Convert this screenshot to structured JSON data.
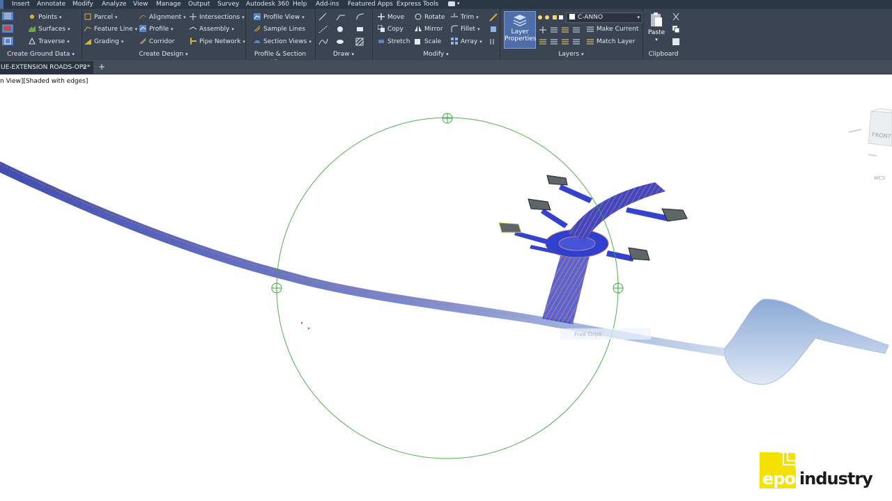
{
  "menu": [
    "Insert",
    "Annotate",
    "Modify",
    "Analyze",
    "View",
    "Manage",
    "Output",
    "Survey",
    "Autodesk 360",
    "Help",
    "Add-ins",
    "Featured Apps",
    "Express Tools"
  ],
  "ribbon": {
    "ground": {
      "title": "Create Ground Data",
      "points": "Points",
      "surfaces": "Surfaces",
      "traverse": "Traverse"
    },
    "design": {
      "title": "Create Design",
      "parcel": "Parcel",
      "feature_line": "Feature Line",
      "grading": "Grading",
      "alignment": "Alignment",
      "profile": "Profile",
      "corridor": "Corridor",
      "intersections": "Intersections",
      "assembly": "Assembly",
      "pipe_network": "Pipe Network"
    },
    "views": {
      "title": "Profile & Section Views",
      "profile_view": "Profile View",
      "sample_lines": "Sample Lines",
      "section_views": "Section Views"
    },
    "draw": {
      "title": "Draw"
    },
    "modify": {
      "title": "Modify",
      "move": "Move",
      "rotate": "Rotate",
      "trim": "Trim",
      "copy": "Copy",
      "mirror": "Mirror",
      "fillet": "Fillet",
      "stretch": "Stretch",
      "scale": "Scale",
      "array": "Array"
    },
    "layers": {
      "title": "Layers",
      "layer_properties": "Layer Properties",
      "layer_name": "C-ANNO",
      "make_current": "Make Current",
      "match_layer": "Match Layer"
    },
    "clipboard": {
      "title": "Clipboard",
      "paste": "Paste"
    }
  },
  "tabs": {
    "document": "UE-EXTENSION ROADS-OP2*",
    "close": "×",
    "add": "+"
  },
  "viewport": {
    "label": "n View][Shaded with edges]",
    "viewcube_face": "FRONT",
    "wcs": "WCS",
    "tooltip": "Free Orbit"
  },
  "logo": {
    "word1": "epo",
    "word2": "industry",
    "color": "#f5e100"
  },
  "colors": {
    "menubar": "#2b3646",
    "ribbon": "#3b4453",
    "tabstrip": "#434c59",
    "orbit": "#3aa63a",
    "road": "#3a44c8",
    "highlight": "#3c7fc9"
  }
}
